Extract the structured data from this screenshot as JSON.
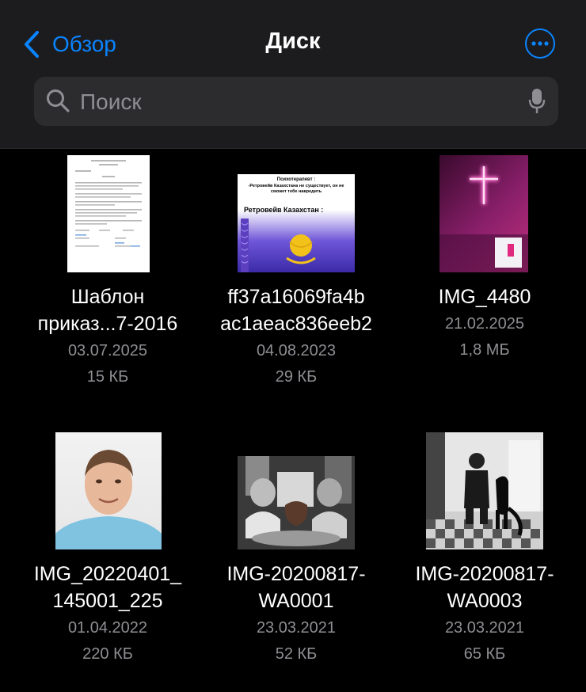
{
  "nav": {
    "back_label": "Обзор",
    "title": "Диск"
  },
  "search": {
    "placeholder": "Поиск"
  },
  "colors": {
    "accent": "#0a84ff",
    "background": "#000000",
    "header": "#1c1c1e",
    "secondary_text": "#8e8e93"
  },
  "files": [
    {
      "name_line1": "Шаблон",
      "name_line2": "приказ...7-2016",
      "date": "03.07.2025",
      "size": "15 КБ"
    },
    {
      "name_line1": "ff37a16069fa4b",
      "name_line2": "ac1aeac836eeb2",
      "date": "04.08.2023",
      "size": "29 КБ",
      "thumb_text1": "Психотерапевт :",
      "thumb_text2": "-Ретровейв Казахстана не существует, он не сможет тебе навредить",
      "thumb_text3": "Ретровейв Казахстан :"
    },
    {
      "name_line1": "IMG_4480",
      "name_line2": "",
      "date": "21.02.2025",
      "size": "1,8 МБ"
    },
    {
      "name_line1": "IMG_20220401_",
      "name_line2": "145001_225",
      "date": "01.04.2022",
      "size": "220 КБ"
    },
    {
      "name_line1": "IMG-20200817-",
      "name_line2": "WA0001",
      "date": "23.03.2021",
      "size": "52 КБ"
    },
    {
      "name_line1": "IMG-20200817-",
      "name_line2": "WA0003",
      "date": "23.03.2021",
      "size": "65 КБ"
    }
  ]
}
